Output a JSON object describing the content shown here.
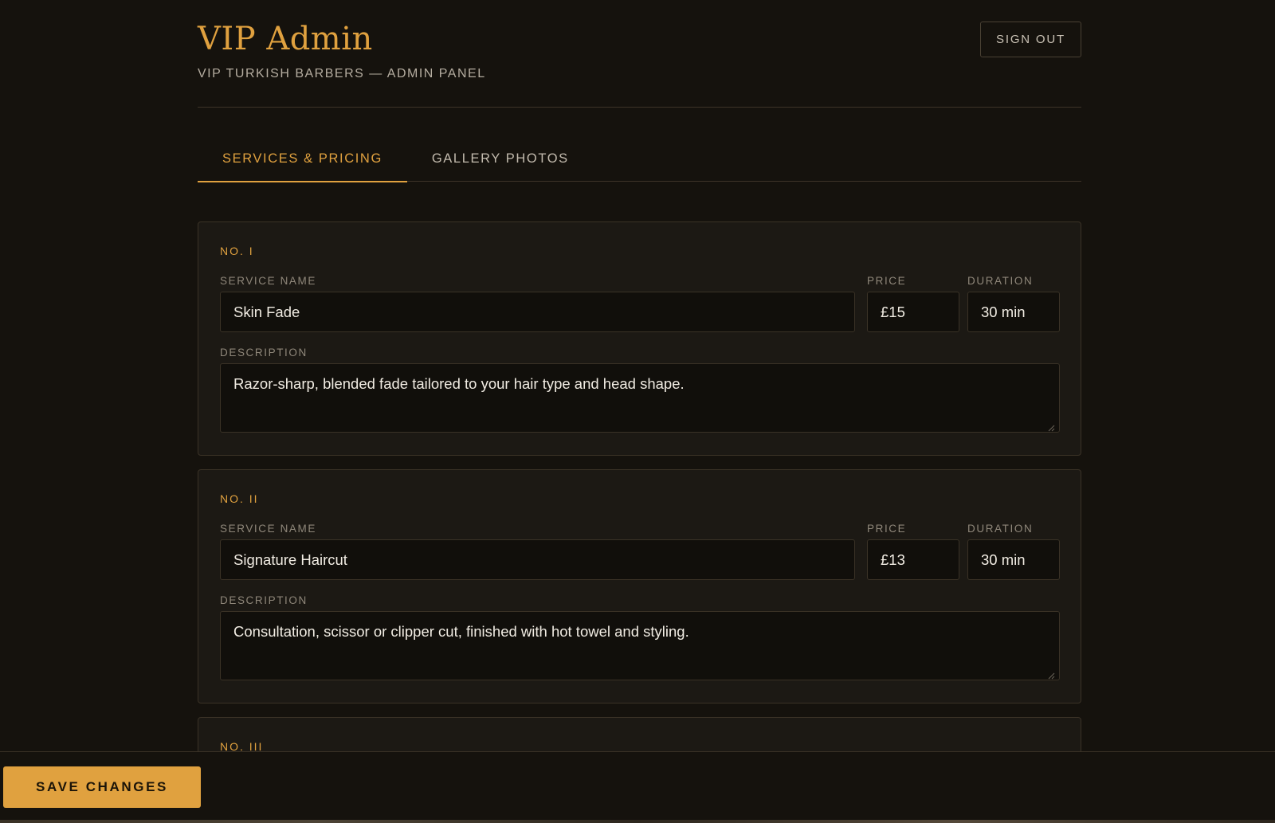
{
  "header": {
    "title": "VIP Admin",
    "subtitle": "VIP TURKISH BARBERS — ADMIN PANEL",
    "sign_out_label": "SIGN OUT"
  },
  "tabs": [
    {
      "label": "SERVICES & PRICING",
      "active": true
    },
    {
      "label": "GALLERY PHOTOS",
      "active": false
    }
  ],
  "labels": {
    "service_name": "SERVICE NAME",
    "price": "PRICE",
    "duration": "DURATION",
    "description": "DESCRIPTION"
  },
  "services": [
    {
      "number": "NO. I",
      "name": "Skin Fade",
      "price": "£15",
      "duration": "30 min",
      "description": "Razor-sharp, blended fade tailored to your hair type and head shape."
    },
    {
      "number": "NO. II",
      "name": "Signature Haircut",
      "price": "£13",
      "duration": "30 min",
      "description": "Consultation, scissor or clipper cut, finished with hot towel and styling."
    },
    {
      "number": "NO. III"
    }
  ],
  "footer": {
    "save_label": "SAVE CHANGES"
  },
  "colors": {
    "background": "#15120d",
    "accent": "#e0a13f",
    "card": "#1c1914"
  }
}
